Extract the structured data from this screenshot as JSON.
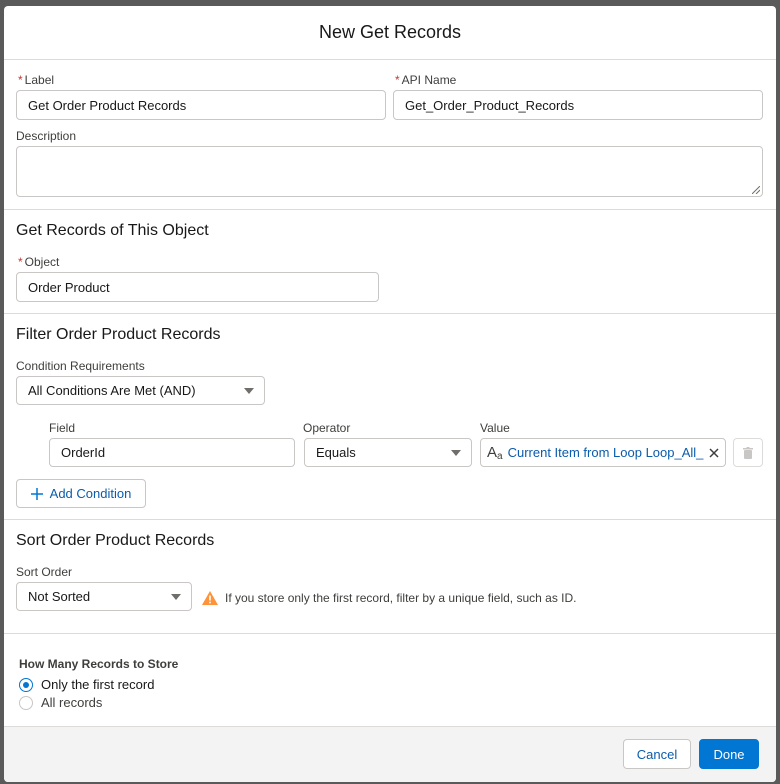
{
  "modal": {
    "title": "New Get Records"
  },
  "fields": {
    "label": {
      "label": "Label",
      "value": "Get Order Product Records"
    },
    "api_name": {
      "label": "API Name",
      "value": "Get_Order_Product_Records"
    },
    "description": {
      "label": "Description",
      "value": ""
    },
    "required_mark": "*"
  },
  "object_section": {
    "title": "Get Records of This Object",
    "object_label": "Object",
    "object_value": "Order Product"
  },
  "filter_section": {
    "title": "Filter Order Product Records",
    "condition_requirements_label": "Condition Requirements",
    "condition_requirements_value": "All Conditions Are Met (AND)",
    "columns": {
      "field": "Field",
      "operator": "Operator",
      "value": "Value"
    },
    "condition": {
      "field": "OrderId",
      "operator": "Equals",
      "value": "Current Item from Loop Loop_All_...",
      "value_icon": "A",
      "value_icon_sub": "a"
    },
    "add_condition_label": "Add Condition"
  },
  "sort_section": {
    "title": "Sort Order Product Records",
    "sort_order_label": "Sort Order",
    "sort_order_value": "Not Sorted",
    "warning": "If you store only the first record, filter by a unique field, such as ID."
  },
  "store_section": {
    "title": "How Many Records to Store",
    "options": [
      "Only the first record",
      "All records"
    ],
    "selected": 0
  },
  "footer": {
    "cancel": "Cancel",
    "done": "Done"
  },
  "colors": {
    "brand": "#0176d3",
    "warning": "#fe9339",
    "link": "#0b5cab"
  }
}
